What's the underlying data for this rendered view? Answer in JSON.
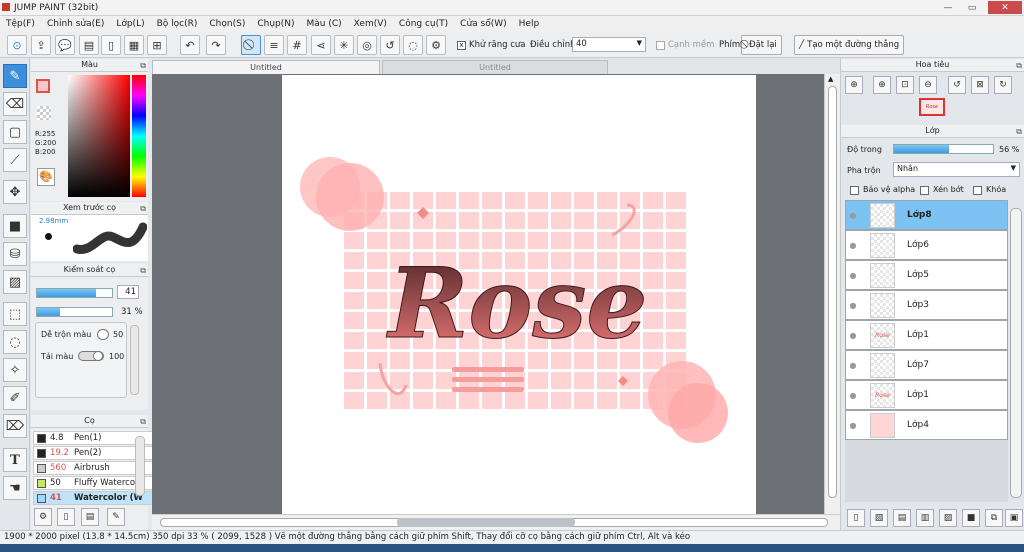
{
  "window": {
    "title": "JUMP PAINT (32bit)"
  },
  "menu": [
    "Tệp(F)",
    "Chỉnh sửa(E)",
    "Lớp(L)",
    "Bộ lọc(R)",
    "Chọn(S)",
    "Chụp(N)",
    "Màu (C)",
    "Xem(V)",
    "Công cụ(T)",
    "Cửa sổ(W)",
    "Help"
  ],
  "toolbar": {
    "antialias_label": "Khử răng cưa",
    "adjust_label": "Điều chỉnh",
    "adjust_value": "40",
    "smooth_label": "Cạnh mềm",
    "key_label": "Phím",
    "reset_label": "Đặt lại",
    "line_label": "Tạo một đường thẳng"
  },
  "tabs": {
    "active": "Untitled",
    "inactive": "Untitled"
  },
  "color_panel": {
    "title": "Màu",
    "r": "R:255",
    "g": "G:200",
    "b": "B:200",
    "main_color": "#ffc8c8"
  },
  "brush_preview": {
    "title": "Xem trước cọ",
    "size": "2.98mm"
  },
  "brush_control": {
    "title": "Kiểm soát cọ",
    "size_value": "41",
    "size_fraction": 0.78,
    "opacity_value": "31 %",
    "opacity_fraction": 0.31,
    "blend_label": "Dễ trộn màu",
    "blend_value": "50",
    "reload_label": "Tải màu",
    "reload_value": "100"
  },
  "brush_list": {
    "title": "Cọ",
    "items": [
      {
        "size": "4.8",
        "name": "Pen(1)",
        "color": "#222222",
        "size_color": "#222"
      },
      {
        "size": "19.2",
        "name": "Pen(2)",
        "color": "#222222",
        "size_color": "#d9534f"
      },
      {
        "size": "560",
        "name": "Airbrush",
        "color": "#cccccc",
        "size_color": "#d9534f"
      },
      {
        "size": "50",
        "name": "Fluffy Waterco",
        "color": "#c7e66a",
        "size_color": "#222"
      },
      {
        "size": "41",
        "name": "Watercolor (W",
        "color": "#9fd8f8",
        "size_color": "#d9534f"
      }
    ]
  },
  "navigator": {
    "title": "Hoa tiêu"
  },
  "layers_panel": {
    "title": "Lớp",
    "opacity_label": "Độ trong",
    "opacity_value": "56 %",
    "opacity_fraction": 0.56,
    "blend_label": "Pha trộn",
    "blend_value": "Nhân",
    "protect_alpha": "Bảo vệ alpha",
    "clip": "Xén bớt",
    "lock": "Khóa"
  },
  "layers": [
    {
      "name": "Lớp8",
      "thumb": ""
    },
    {
      "name": "Lớp6",
      "thumb": ""
    },
    {
      "name": "Lớp5",
      "thumb": ""
    },
    {
      "name": "Lớp3",
      "thumb": ""
    },
    {
      "name": "Lớp1",
      "thumb": "Rose"
    },
    {
      "name": "Lớp7",
      "thumb": ""
    },
    {
      "name": "Lớp1",
      "thumb": "Rose"
    },
    {
      "name": "Lớp4",
      "thumb": ""
    }
  ],
  "artwork": {
    "text": "Rose"
  },
  "status": {
    "text": "1900 * 2000 pixel  (13.8 * 14.5cm)  350 dpi  33 %  ( 2099, 1528 )  Vẽ một đường thẳng bằng cách giữ phím Shift, Thay đổi cỡ cọ bằng cách giữ phím Ctrl, Alt và kéo"
  }
}
